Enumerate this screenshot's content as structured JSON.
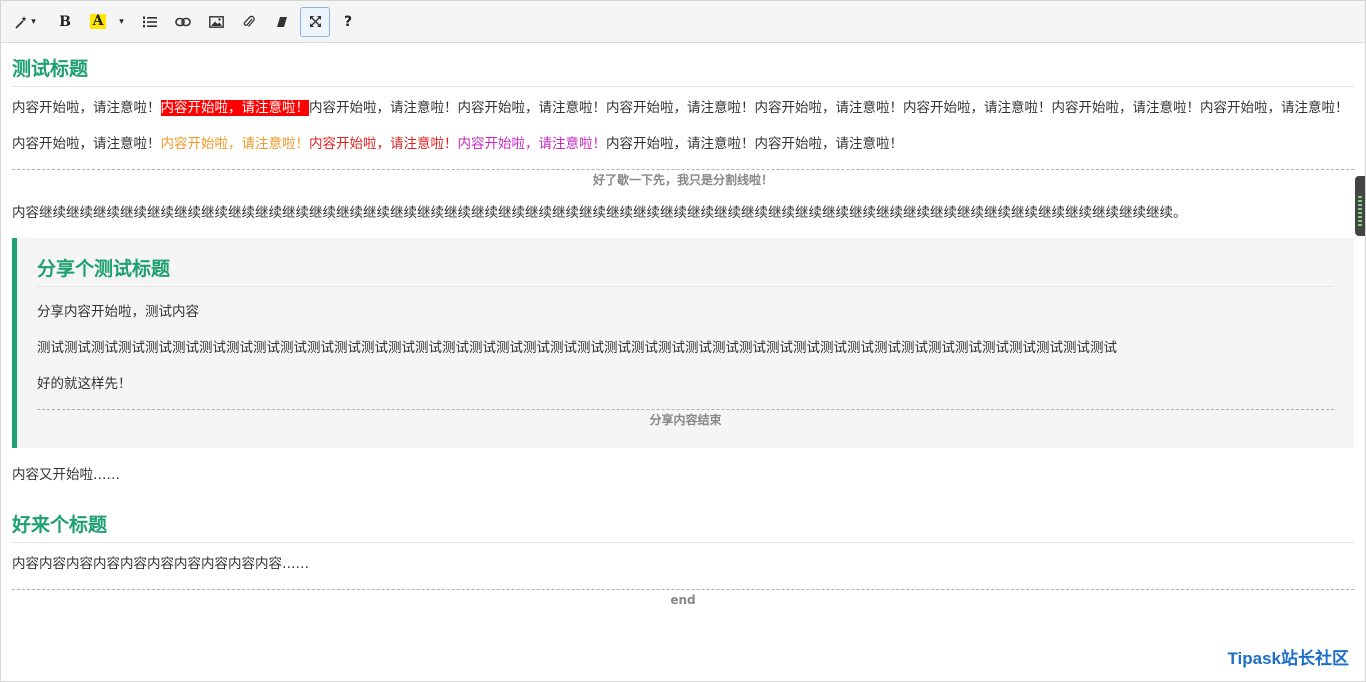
{
  "toolbar": {
    "buttons": [
      {
        "name": "magic-wand",
        "icon": "magic-wand-icon"
      },
      {
        "name": "bold",
        "label": "B"
      },
      {
        "name": "highlight",
        "label": "A"
      },
      {
        "name": "ordered-list",
        "icon": "ordered-list-icon"
      },
      {
        "name": "link",
        "icon": "link-icon"
      },
      {
        "name": "image",
        "icon": "image-icon"
      },
      {
        "name": "attachment",
        "icon": "paperclip-icon"
      },
      {
        "name": "eraser",
        "icon": "eraser-icon"
      },
      {
        "name": "fullscreen",
        "icon": "fullscreen-icon"
      },
      {
        "name": "help",
        "label": "?"
      }
    ],
    "bold_label": "B",
    "highlight_label": "A",
    "help_label": "?"
  },
  "content": {
    "heading1": "测试标题",
    "para1": {
      "before": "内容开始啦，请注意啦！",
      "highlighted": "内容开始啦，请注意啦！",
      "after": "内容开始啦，请注意啦！内容开始啦，请注意啦！内容开始啦，请注意啦！内容开始啦，请注意啦！内容开始啦，请注意啦！内容开始啦，请注意啦！内容开始啦，请注意啦！"
    },
    "para2": {
      "plain1": "内容开始啦，请注意啦！",
      "orange": "内容开始啦，请注意啦！",
      "red": "内容开始啦，请注意啦！",
      "magenta": "内容开始啦，请注意啦！",
      "plain2": "内容开始啦，请注意啦！内容开始啦，请注意啦！"
    },
    "divider1": "好了歇一下先，我只是分割线啦！",
    "para3": "内容继续继续继续继续继续继续继续继续继续继续继续继续继续继续继续继续继续继续继续继续继续继续继续继续继续继续继续继续继续继续继续继续继续继续继续继续继续继续继续继续继续继续。",
    "quote": {
      "heading": "分享个测试标题",
      "line1": "分享内容开始啦，测试内容",
      "line2": "测试测试测试测试测试测试测试测试测试测试测试测试测试测试测试测试测试测试测试测试测试测试测试测试测试测试测试测试测试测试测试测试测试测试测试测试测试测试测试测试",
      "line3": "好的就这样先！",
      "end_label": "分享内容结束"
    },
    "para4": "内容又开始啦……",
    "heading2": "好来个标题",
    "para5": "内容内容内容内容内容内容内容内容内容内容……",
    "end_label": "end"
  },
  "watermark": "Tipask站长社区",
  "colors": {
    "heading": "#1ea070",
    "highlight_bg": "#ff0000",
    "orange": "#ee9a28",
    "red": "#e02222",
    "magenta": "#c828c8",
    "watermark": "#1e6fc8"
  }
}
